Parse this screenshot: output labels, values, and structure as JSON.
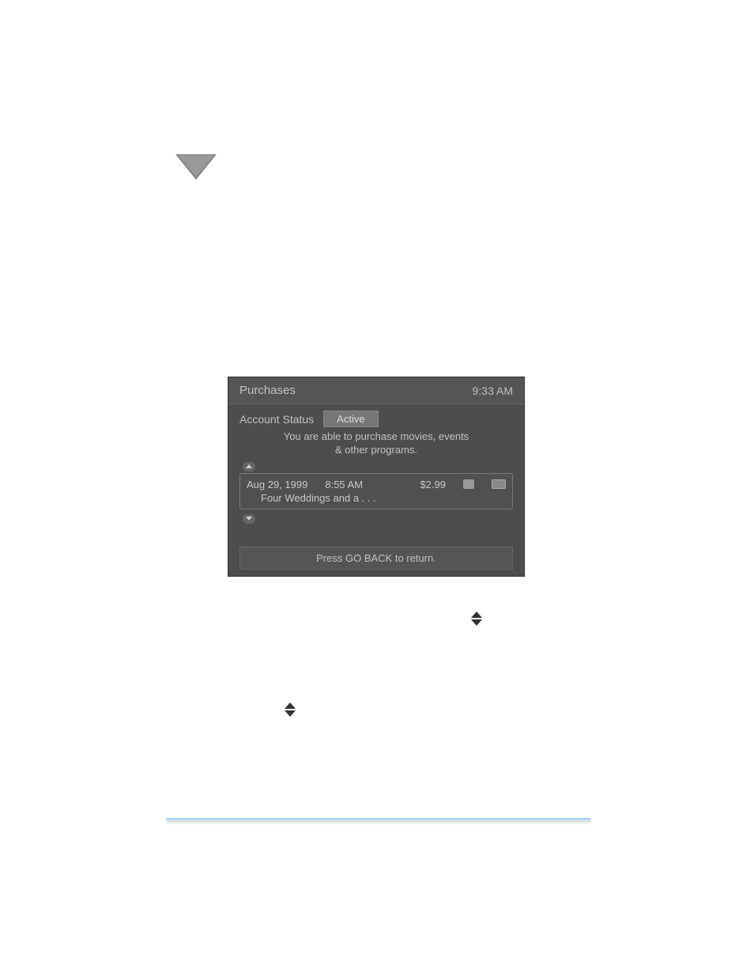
{
  "screenshot": {
    "title": "Purchases",
    "time": "9:33 AM",
    "account_status_label": "Account Status",
    "account_status_value": "Active",
    "status_line1": "You are able to purchase movies, events",
    "status_line2": "& other programs.",
    "purchase": {
      "date": "Aug 29, 1999",
      "time": "8:55 AM",
      "price": "$2.99",
      "title": "Four Weddings and a . . ."
    },
    "footer": "Press GO BACK to return."
  }
}
